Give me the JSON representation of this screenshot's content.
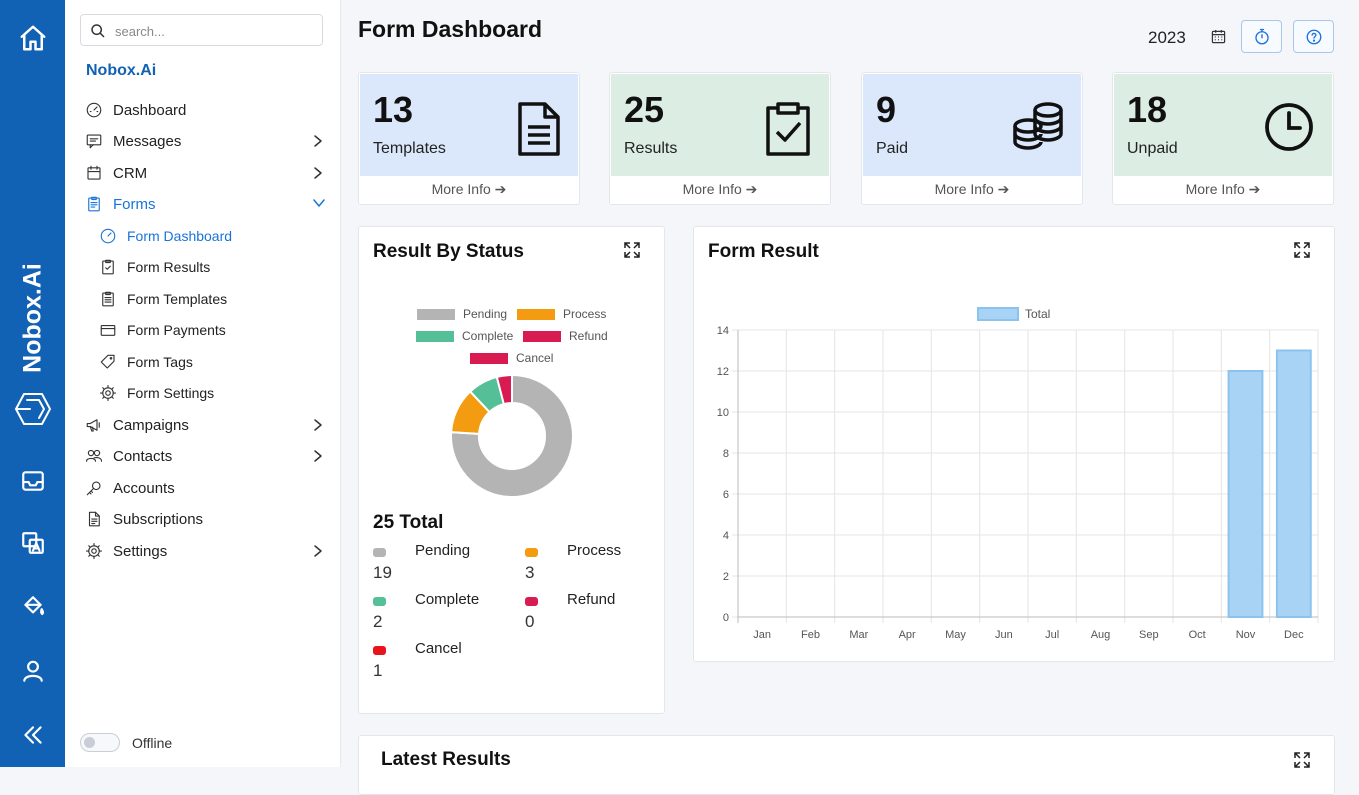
{
  "rail": {
    "brand": "Nobox.Ai"
  },
  "sidebar": {
    "search_placeholder": "search...",
    "brand": "Nobox.Ai",
    "items": [
      {
        "label": "Dashboard"
      },
      {
        "label": "Messages"
      },
      {
        "label": "CRM"
      },
      {
        "label": "Forms"
      },
      {
        "label": "Form Dashboard"
      },
      {
        "label": "Form Results"
      },
      {
        "label": "Form Templates"
      },
      {
        "label": "Form Payments"
      },
      {
        "label": "Form Tags"
      },
      {
        "label": "Form Settings"
      },
      {
        "label": "Campaigns"
      },
      {
        "label": "Contacts"
      },
      {
        "label": "Accounts"
      },
      {
        "label": "Subscriptions"
      },
      {
        "label": "Settings"
      }
    ],
    "offline_label": "Offline"
  },
  "header": {
    "title": "Form Dashboard",
    "year": "2023"
  },
  "cards": [
    {
      "value": "13",
      "label": "Templates",
      "more": "More Info",
      "color": "#dbe8fc"
    },
    {
      "value": "25",
      "label": "Results",
      "more": "More Info",
      "color": "#dceee4"
    },
    {
      "value": "9",
      "label": "Paid",
      "more": "More Info",
      "color": "#dbe8fc"
    },
    {
      "value": "18",
      "label": "Unpaid",
      "more": "More Info",
      "color": "#dceee4"
    }
  ],
  "status_panel": {
    "title": "Result By Status",
    "total": "25 Total",
    "stats": [
      {
        "label": "Pending",
        "value": "19",
        "color": "#b4b4b4"
      },
      {
        "label": "Process",
        "value": "3",
        "color": "#f39c12"
      },
      {
        "label": "Complete",
        "value": "2",
        "color": "#55bf98"
      },
      {
        "label": "Refund",
        "value": "0",
        "color": "#d81b50"
      },
      {
        "label": "Cancel",
        "value": "1",
        "color": "#e8141c"
      }
    ]
  },
  "result_panel": {
    "title": "Form Result"
  },
  "latest_panel": {
    "title": "Latest Results"
  },
  "chart_data": [
    {
      "type": "pie",
      "categories": [
        "Pending",
        "Process",
        "Complete",
        "Refund",
        "Cancel"
      ],
      "values": [
        19,
        3,
        2,
        0,
        1
      ],
      "colors": [
        "#b4b4b4",
        "#f39c12",
        "#55bf98",
        "#d81b50",
        "#d81b50"
      ],
      "legend": "top"
    },
    {
      "type": "bar",
      "categories": [
        "Jan",
        "Feb",
        "Mar",
        "Apr",
        "May",
        "Jun",
        "Jul",
        "Aug",
        "Sep",
        "Oct",
        "Nov",
        "Dec"
      ],
      "series": [
        {
          "name": "Total",
          "values": [
            0,
            0,
            0,
            0,
            0,
            0,
            0,
            0,
            0,
            0,
            12,
            13
          ]
        }
      ],
      "ylim": [
        0,
        14
      ],
      "yticks": [
        0,
        2,
        4,
        6,
        8,
        10,
        12,
        14
      ],
      "grid": true,
      "legend": "top",
      "color": "#a9d3f5"
    }
  ]
}
